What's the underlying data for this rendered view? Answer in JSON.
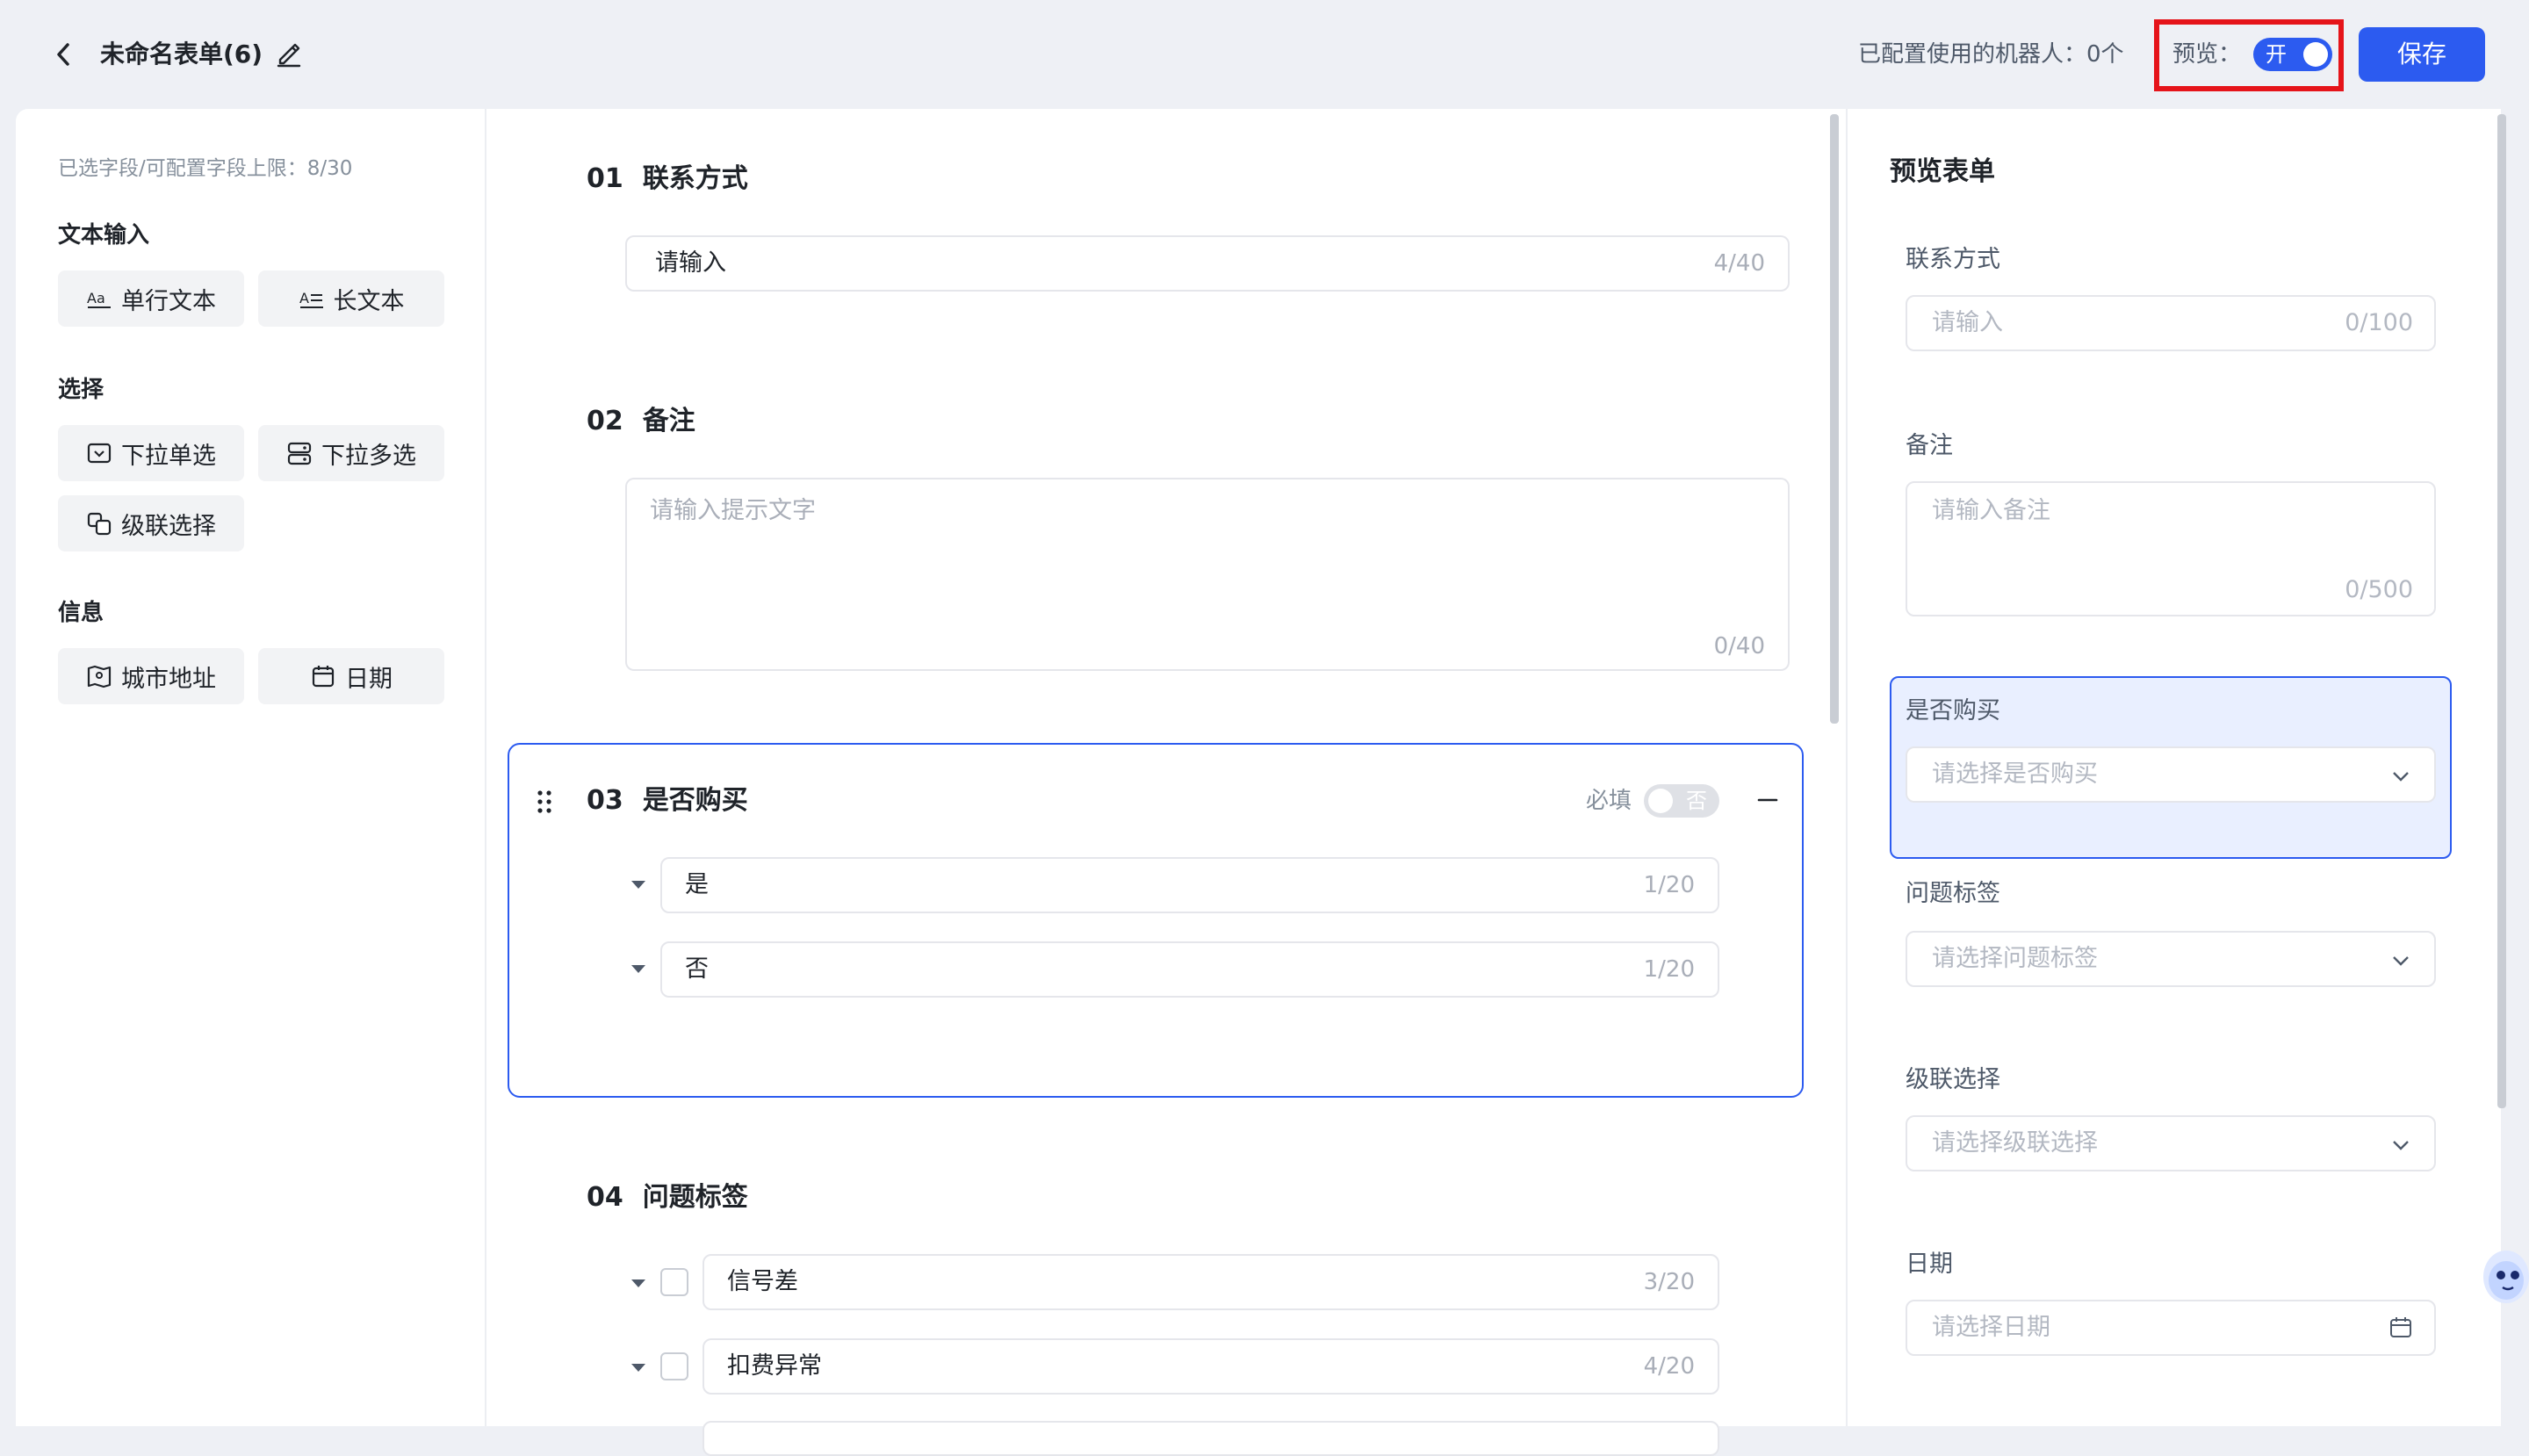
{
  "header": {
    "title": "未命名表单(6)",
    "robots_label": "已配置使用的机器人：0个",
    "preview_label": "预览：",
    "preview_toggle": "开",
    "save_label": "保存"
  },
  "left": {
    "field_limit": "已选字段/可配置字段上限：8/30",
    "groups": [
      {
        "title": "文本输入",
        "items": [
          {
            "label": "单行文本",
            "icon": "single-line-text-icon"
          },
          {
            "label": "长文本",
            "icon": "long-text-icon"
          }
        ]
      },
      {
        "title": "选择",
        "items": [
          {
            "label": "下拉单选",
            "icon": "dropdown-single-icon"
          },
          {
            "label": "下拉多选",
            "icon": "dropdown-multi-icon"
          },
          {
            "label": "级联选择",
            "icon": "cascade-icon"
          }
        ]
      },
      {
        "title": "信息",
        "items": [
          {
            "label": "城市地址",
            "icon": "map-icon"
          },
          {
            "label": "日期",
            "icon": "calendar-icon"
          }
        ]
      }
    ]
  },
  "center": {
    "q1": {
      "num": "01",
      "title": "联系方式",
      "value": "请输入",
      "count": "4/40"
    },
    "q2": {
      "num": "02",
      "title": "备注",
      "placeholder": "请输入提示文字",
      "count": "0/40"
    },
    "q3": {
      "num": "03",
      "title": "是否购买",
      "required_label": "必填",
      "required_toggle": "否",
      "options": [
        {
          "value": "是",
          "count": "1/20"
        },
        {
          "value": "否",
          "count": "1/20"
        }
      ]
    },
    "q4": {
      "num": "04",
      "title": "问题标签",
      "options": [
        {
          "value": "信号差",
          "count": "3/20"
        },
        {
          "value": "扣费异常",
          "count": "4/20"
        }
      ]
    }
  },
  "preview": {
    "title": "预览表单",
    "fields": {
      "contact": {
        "label": "联系方式",
        "placeholder": "请输入",
        "count": "0/100"
      },
      "remark": {
        "label": "备注",
        "placeholder": "请输入备注",
        "count": "0/500"
      },
      "purchase": {
        "label": "是否购买",
        "placeholder": "请选择是否购买"
      },
      "tags": {
        "label": "问题标签",
        "placeholder": "请选择问题标签"
      },
      "cascade": {
        "label": "级联选择",
        "placeholder": "请选择级联选择"
      },
      "date": {
        "label": "日期",
        "placeholder": "请选择日期"
      }
    }
  },
  "colors": {
    "accent": "#2c5bf0",
    "highlight_border": "#e5141a"
  }
}
